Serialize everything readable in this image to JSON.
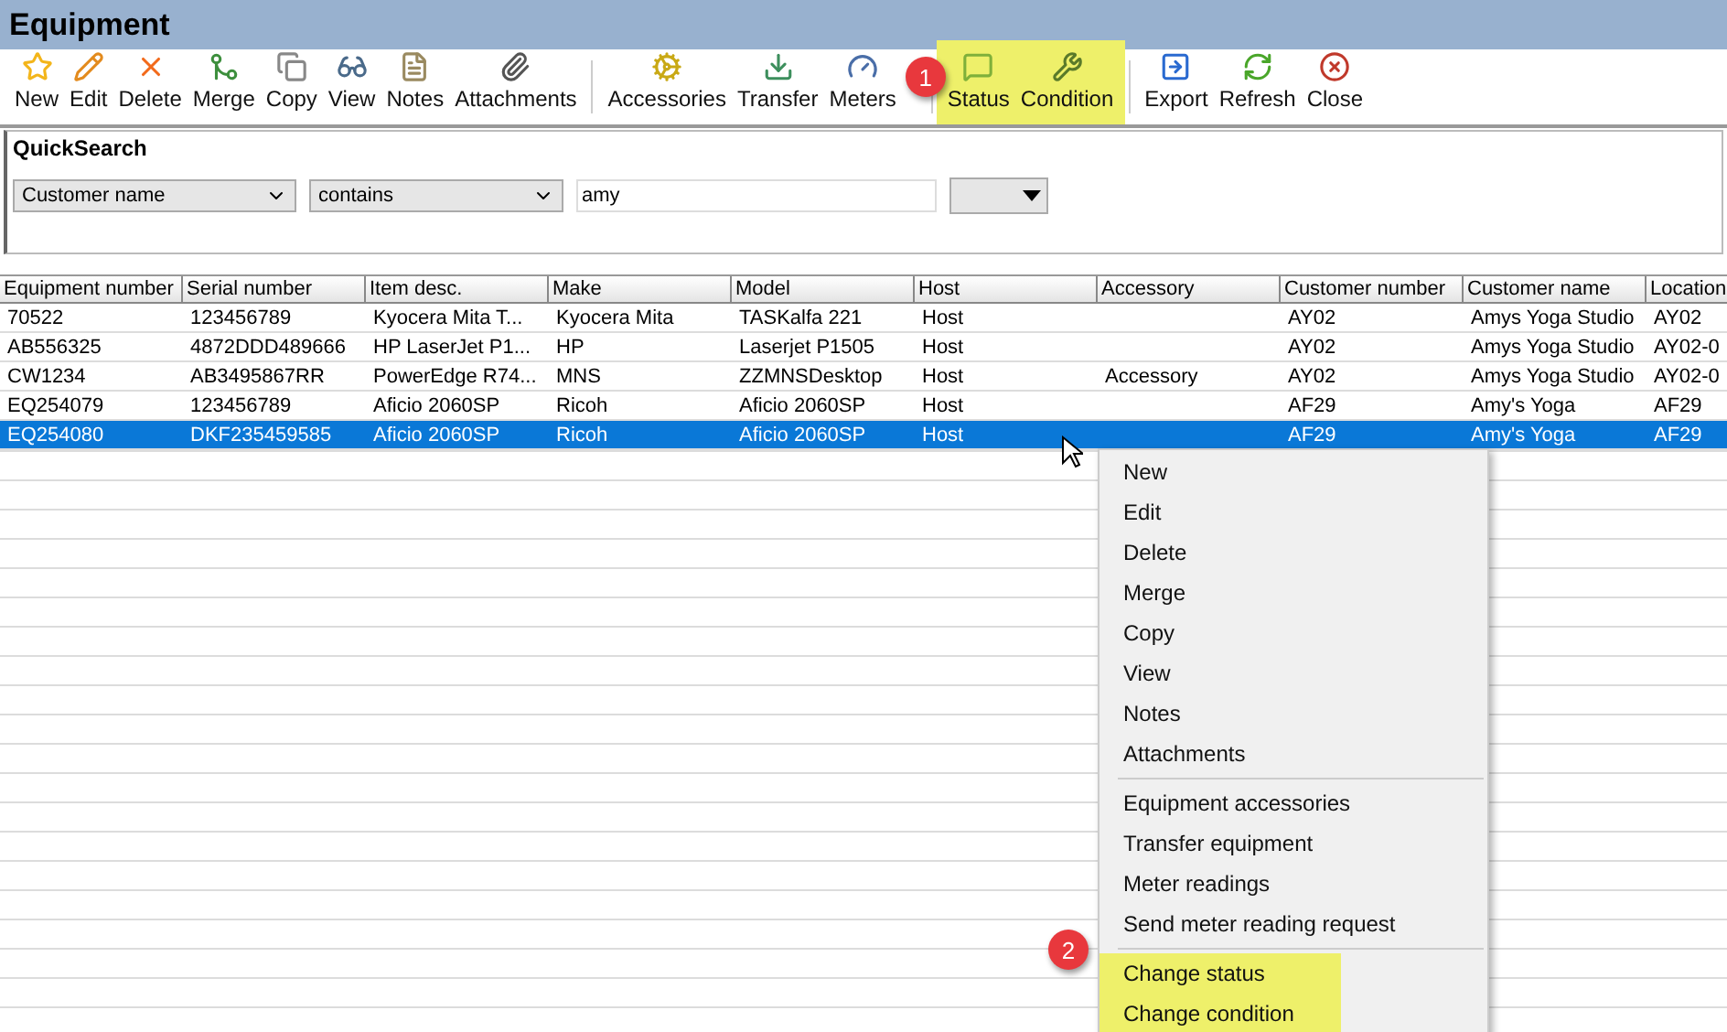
{
  "window": {
    "title": "Equipment"
  },
  "toolbar": [
    [
      {
        "label": "New"
      },
      {
        "label": "Edit"
      },
      {
        "label": "Delete"
      },
      {
        "label": "Merge"
      },
      {
        "label": "Copy"
      },
      {
        "label": "View"
      },
      {
        "label": "Notes"
      },
      {
        "label": "Attachments"
      }
    ],
    [
      {
        "label": "Accessories"
      },
      {
        "label": "Transfer"
      },
      {
        "label": "Meters",
        "badge": "1"
      }
    ],
    [
      {
        "label": "Status",
        "highlighted": true
      },
      {
        "label": "Condition",
        "highlighted": true
      }
    ],
    [
      {
        "label": "Export"
      },
      {
        "label": "Refresh"
      },
      {
        "label": "Close"
      }
    ]
  ],
  "quicksearch": {
    "title": "QuickSearch",
    "field": "Customer name",
    "operator": "contains",
    "value": "amy"
  },
  "table": {
    "columns": [
      "Equipment number",
      "Serial number",
      "Item desc.",
      "Make",
      "Model",
      "Host",
      "Accessory",
      "Customer number",
      "Customer name",
      "Location"
    ],
    "rows": [
      {
        "selected": false,
        "cells": [
          "70522",
          "123456789",
          "Kyocera Mita T...",
          "Kyocera Mita",
          "TASKalfa 221",
          "Host",
          "",
          "AY02",
          "Amys Yoga Studio",
          "AY02"
        ]
      },
      {
        "selected": false,
        "cells": [
          "AB556325",
          "4872DDD489666",
          "HP LaserJet P1...",
          "HP",
          "Laserjet P1505",
          "Host",
          "",
          "AY02",
          "Amys Yoga Studio",
          "AY02-0"
        ]
      },
      {
        "selected": false,
        "cells": [
          "CW1234",
          "AB3495867RR",
          "PowerEdge R74...",
          "MNS",
          "ZZMNSDesktop",
          "Host",
          "Accessory",
          "AY02",
          "Amys Yoga Studio",
          "AY02-0"
        ]
      },
      {
        "selected": false,
        "cells": [
          "EQ254079",
          "123456789",
          "Aficio 2060SP",
          "Ricoh",
          "Aficio 2060SP",
          "Host",
          "",
          "AF29",
          "Amy's Yoga",
          "AF29"
        ]
      },
      {
        "selected": true,
        "cells": [
          "EQ254080",
          "DKF235459585",
          "Aficio 2060SP",
          "Ricoh",
          "Aficio 2060SP",
          "Host",
          "",
          "AF29",
          "Amy's Yoga",
          "AF29"
        ]
      }
    ]
  },
  "context_menu": {
    "badge": "2",
    "groups": [
      [
        {
          "label": "New",
          "highlighted": false
        },
        {
          "label": "Edit",
          "highlighted": false
        },
        {
          "label": "Delete",
          "highlighted": false
        },
        {
          "label": "Merge",
          "highlighted": false
        },
        {
          "label": "Copy",
          "highlighted": false
        },
        {
          "label": "View",
          "highlighted": false
        },
        {
          "label": "Notes",
          "highlighted": false
        },
        {
          "label": "Attachments",
          "highlighted": false
        }
      ],
      [
        {
          "label": "Equipment accessories",
          "highlighted": false
        },
        {
          "label": "Transfer equipment",
          "highlighted": false
        },
        {
          "label": "Meter readings",
          "highlighted": false
        },
        {
          "label": "Send meter reading request",
          "highlighted": false
        }
      ],
      [
        {
          "label": "Change status",
          "highlighted": true
        },
        {
          "label": "Change condition",
          "highlighted": true
        }
      ]
    ]
  }
}
